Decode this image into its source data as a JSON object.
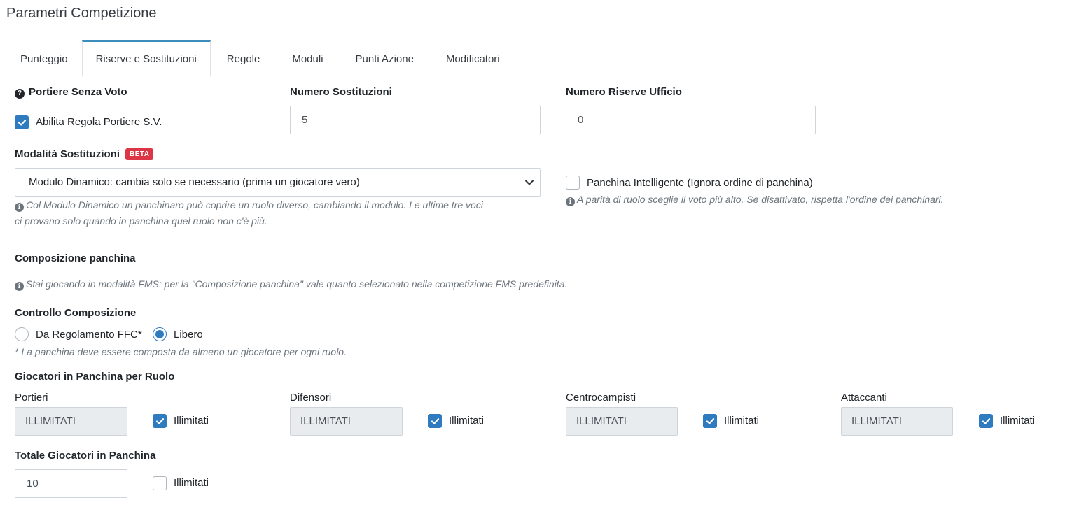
{
  "page": {
    "title": "Parametri Competizione"
  },
  "tabs": [
    {
      "label": "Punteggio",
      "active": false
    },
    {
      "label": "Riserve e Sostituzioni",
      "active": true
    },
    {
      "label": "Regole",
      "active": false
    },
    {
      "label": "Moduli",
      "active": false
    },
    {
      "label": "Punti Azione",
      "active": false
    },
    {
      "label": "Modificatori",
      "active": false
    }
  ],
  "portiere": {
    "label": "Portiere Senza Voto",
    "checkbox_label": "Abilita Regola Portiere S.V.",
    "checked": true
  },
  "sostituzioni": {
    "label": "Numero Sostituzioni",
    "value": "5"
  },
  "riserve_ufficio": {
    "label": "Numero Riserve Ufficio",
    "value": "0"
  },
  "modalita": {
    "label": "Modalità Sostituzioni",
    "badge": "BETA",
    "selected": "Modulo Dinamico: cambia solo se necessario (prima un giocatore vero)",
    "help_line1": "Col Modulo Dinamico un panchinaro può coprire un ruolo diverso, cambiando il modulo. Le ultime tre voci",
    "help_line2": "ci provano solo quando in panchina quel ruolo non c'è più."
  },
  "panchina_intelligente": {
    "label": "Panchina Intelligente (Ignora ordine di panchina)",
    "checked": false,
    "help": "A parità di ruolo sceglie il voto più alto. Se disattivato, rispetta l'ordine dei panchinari."
  },
  "composizione": {
    "label": "Composizione panchina",
    "help": "Stai giocando in modalità FMS: per la \"Composizione panchina\" vale quanto selezionato nella competizione FMS predefinita."
  },
  "controllo": {
    "label": "Controllo Composizione",
    "options": [
      {
        "label": "Da Regolamento FFC*",
        "selected": false
      },
      {
        "label": "Libero",
        "selected": true
      }
    ],
    "note": "* La panchina deve essere composta da almeno un giocatore per ogni ruolo."
  },
  "ruoli": {
    "label": "Giocatori in Panchina per Ruolo",
    "items": [
      {
        "name": "Portieri",
        "value": "ILLIMITATI",
        "check_label": "Illimitati",
        "checked": true
      },
      {
        "name": "Difensori",
        "value": "ILLIMITATI",
        "check_label": "Illimitati",
        "checked": true
      },
      {
        "name": "Centrocampisti",
        "value": "ILLIMITATI",
        "check_label": "Illimitati",
        "checked": true
      },
      {
        "name": "Attaccanti",
        "value": "ILLIMITATI",
        "check_label": "Illimitati",
        "checked": true
      }
    ]
  },
  "totale": {
    "label": "Totale Giocatori in Panchina",
    "value": "10",
    "check_label": "Illimitati",
    "checked": false
  },
  "colors": {
    "accent": "#2f7bc0",
    "tab_active": "#3c8dbc",
    "badge": "#dc3545"
  }
}
